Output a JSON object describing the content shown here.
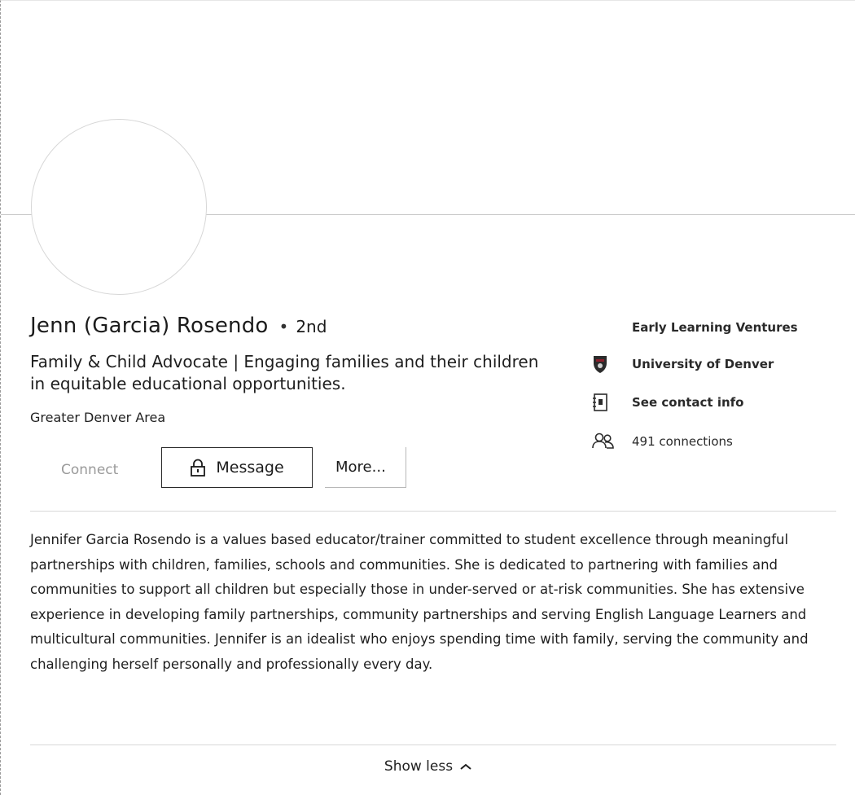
{
  "profile": {
    "name": "Jenn (Garcia) Rosendo",
    "separator": "•",
    "degree": "2nd",
    "headline": "Family & Child Advocate | Engaging families and their children in equitable educational opportunities.",
    "location": "Greater Denver Area"
  },
  "actions": {
    "connect_label": "Connect",
    "message_label": "Message",
    "more_label": "More..."
  },
  "side": {
    "company": "Early Learning Ventures",
    "school": "University of Denver",
    "contact_info": "See contact info",
    "connections": "491 connections"
  },
  "summary": {
    "text": "Jennifer Garcia Rosendo is a values based educator/trainer committed to student excellence through meaningful partnerships with children, families, schools and communities. She is dedicated to partnering with families and communities to support all children but especially those in under-served or at-risk communities. She has extensive experience in developing family partnerships, community partnerships and serving English Language Learners and multicultural communities. Jennifer is an idealist who enjoys spending time with family, serving the community and challenging herself personally and professionally every day."
  },
  "footer": {
    "show_less_label": "Show less"
  },
  "icons": {
    "message": "lock-icon",
    "school": "university-shield-icon",
    "contact": "contact-card-icon",
    "connections": "people-icon",
    "show_less": "chevron-up-icon"
  }
}
